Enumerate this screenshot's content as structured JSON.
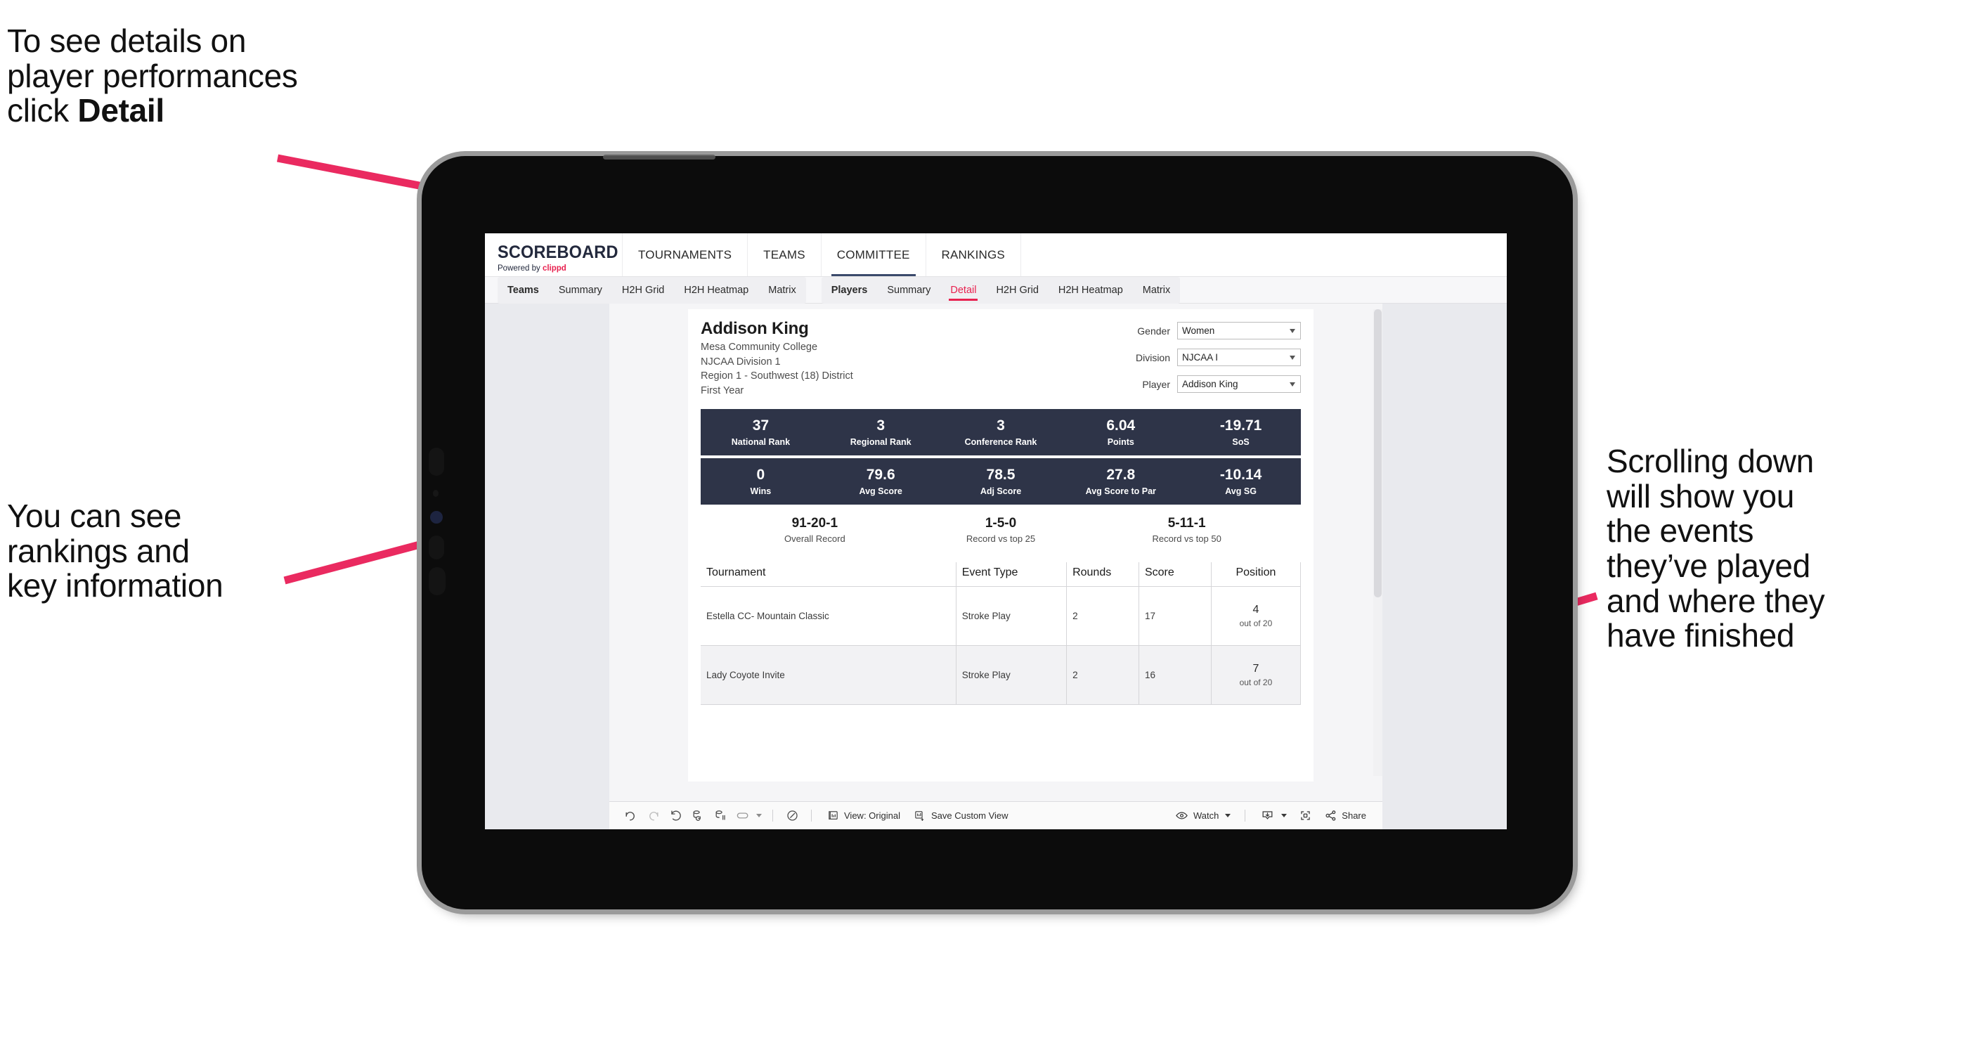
{
  "annotations": {
    "detail": "To see details on\nplayer performances\nclick ",
    "detail_bold": "Detail",
    "rankings": "You can see\nrankings and\nkey information",
    "scrolling": "Scrolling down\nwill show you\nthe events\nthey’ve played\nand where they\nhave finished"
  },
  "colors": {
    "accent": "#e8214f",
    "band": "#2e3448",
    "nav_active": "#3b4a6b"
  },
  "app": {
    "logo": {
      "title": "SCOREBOARD",
      "powered_prefix": "Powered by ",
      "brand": "clippd"
    },
    "nav": [
      {
        "label": "TOURNAMENTS",
        "active": false
      },
      {
        "label": "TEAMS",
        "active": false
      },
      {
        "label": "COMMITTEE",
        "active": true
      },
      {
        "label": "RANKINGS",
        "active": false
      }
    ],
    "subnav": {
      "group_teams": [
        {
          "label": "Teams",
          "head": true,
          "active": false
        },
        {
          "label": "Summary",
          "head": false,
          "active": false
        },
        {
          "label": "H2H Grid",
          "head": false,
          "active": false
        },
        {
          "label": "H2H Heatmap",
          "head": false,
          "active": false
        },
        {
          "label": "Matrix",
          "head": false,
          "active": false
        }
      ],
      "group_players": [
        {
          "label": "Players",
          "head": true,
          "active": false
        },
        {
          "label": "Summary",
          "head": false,
          "active": false
        },
        {
          "label": "Detail",
          "head": false,
          "active": true
        },
        {
          "label": "H2H Grid",
          "head": false,
          "active": false
        },
        {
          "label": "H2H Heatmap",
          "head": false,
          "active": false
        },
        {
          "label": "Matrix",
          "head": false,
          "active": false
        }
      ]
    }
  },
  "player": {
    "name": "Addison King",
    "school": "Mesa Community College",
    "division": "NJCAA Division 1",
    "region": "Region 1 - Southwest (18) District",
    "year": "First Year"
  },
  "filters": [
    {
      "label": "Gender",
      "value": "Women"
    },
    {
      "label": "Division",
      "value": "NJCAA I"
    },
    {
      "label": "Player",
      "value": "Addison King"
    }
  ],
  "stats_band_1": [
    {
      "value": "37",
      "label": "National Rank"
    },
    {
      "value": "3",
      "label": "Regional Rank"
    },
    {
      "value": "3",
      "label": "Conference Rank"
    },
    {
      "value": "6.04",
      "label": "Points"
    },
    {
      "value": "-19.71",
      "label": "SoS"
    }
  ],
  "stats_band_2": [
    {
      "value": "0",
      "label": "Wins"
    },
    {
      "value": "79.6",
      "label": "Avg Score"
    },
    {
      "value": "78.5",
      "label": "Adj Score"
    },
    {
      "value": "27.8",
      "label": "Avg Score to Par"
    },
    {
      "value": "-10.14",
      "label": "Avg SG"
    }
  ],
  "records": [
    {
      "value": "91-20-1",
      "label": "Overall Record"
    },
    {
      "value": "1-5-0",
      "label": "Record vs top 25"
    },
    {
      "value": "5-11-1",
      "label": "Record vs top 50"
    }
  ],
  "events_table": {
    "columns": [
      "Tournament",
      "Event Type",
      "Rounds",
      "Score",
      "Position"
    ],
    "rows": [
      {
        "tournament": "Estella CC- Mountain Classic",
        "event_type": "Stroke Play",
        "rounds": "2",
        "score": "17",
        "position": "4",
        "position_out_of": "out of 20"
      },
      {
        "tournament": "Lady Coyote Invite",
        "event_type": "Stroke Play",
        "rounds": "2",
        "score": "16",
        "position": "7",
        "position_out_of": "out of 20"
      }
    ]
  },
  "toolbar": {
    "view_label": "View: Original",
    "save_label": "Save Custom View",
    "watch_label": "Watch",
    "share_label": "Share"
  }
}
